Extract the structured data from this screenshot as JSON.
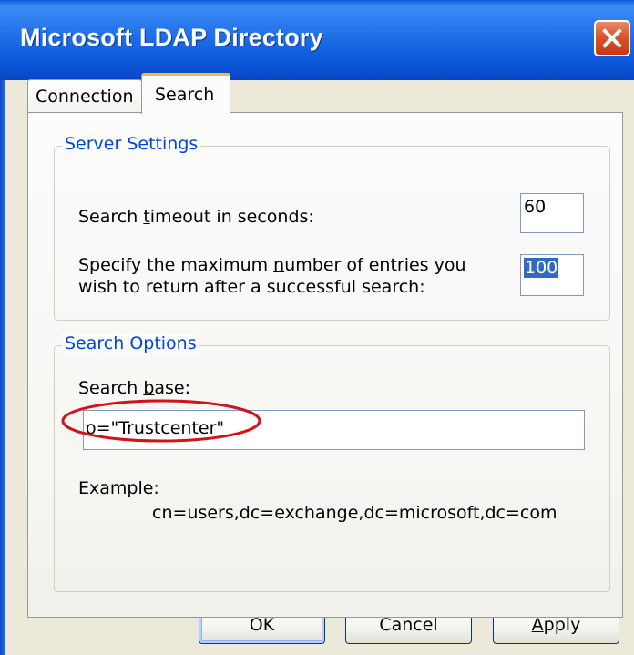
{
  "window": {
    "title": "Microsoft LDAP Directory"
  },
  "tabs": [
    {
      "label": "Connection",
      "active": false
    },
    {
      "label": "Search",
      "active": true
    }
  ],
  "server_settings": {
    "legend": "Server Settings",
    "timeout_label_pre": "Search ",
    "timeout_label_u": "t",
    "timeout_label_post": "imeout in seconds:",
    "timeout_value": "60",
    "max_label_line1_pre": "Specify the maximum ",
    "max_label_line1_u": "n",
    "max_label_line1_post": "umber of entries you",
    "max_label_line2": "wish to return after a successful search:",
    "max_value": "100"
  },
  "search_options": {
    "legend": "Search Options",
    "base_label_pre": "Search ",
    "base_label_u": "b",
    "base_label_post": "ase:",
    "base_value": "o=\"Trustcenter\"",
    "example_label": "Example:",
    "example_value": "cn=users,dc=exchange,dc=microsoft,dc=com"
  },
  "buttons": {
    "ok": "OK",
    "cancel": "Cancel",
    "apply_u": "A",
    "apply_rest": "pply"
  },
  "colors": {
    "title_bar": "#1f6fe8",
    "group_legend": "#0046d5",
    "highlight_ellipse": "#d0141a",
    "selection": "#316ac5"
  }
}
